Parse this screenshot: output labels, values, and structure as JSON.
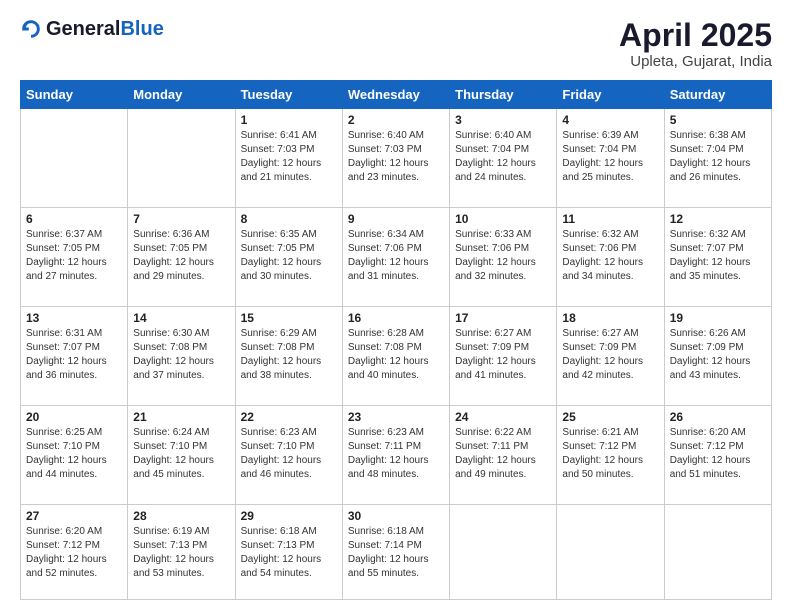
{
  "header": {
    "logo_general": "General",
    "logo_blue": "Blue",
    "title": "April 2025",
    "location": "Upleta, Gujarat, India"
  },
  "days_of_week": [
    "Sunday",
    "Monday",
    "Tuesday",
    "Wednesday",
    "Thursday",
    "Friday",
    "Saturday"
  ],
  "weeks": [
    [
      {
        "day": "",
        "info": ""
      },
      {
        "day": "",
        "info": ""
      },
      {
        "day": "1",
        "info": "Sunrise: 6:41 AM\nSunset: 7:03 PM\nDaylight: 12 hours and 21 minutes."
      },
      {
        "day": "2",
        "info": "Sunrise: 6:40 AM\nSunset: 7:03 PM\nDaylight: 12 hours and 23 minutes."
      },
      {
        "day": "3",
        "info": "Sunrise: 6:40 AM\nSunset: 7:04 PM\nDaylight: 12 hours and 24 minutes."
      },
      {
        "day": "4",
        "info": "Sunrise: 6:39 AM\nSunset: 7:04 PM\nDaylight: 12 hours and 25 minutes."
      },
      {
        "day": "5",
        "info": "Sunrise: 6:38 AM\nSunset: 7:04 PM\nDaylight: 12 hours and 26 minutes."
      }
    ],
    [
      {
        "day": "6",
        "info": "Sunrise: 6:37 AM\nSunset: 7:05 PM\nDaylight: 12 hours and 27 minutes."
      },
      {
        "day": "7",
        "info": "Sunrise: 6:36 AM\nSunset: 7:05 PM\nDaylight: 12 hours and 29 minutes."
      },
      {
        "day": "8",
        "info": "Sunrise: 6:35 AM\nSunset: 7:05 PM\nDaylight: 12 hours and 30 minutes."
      },
      {
        "day": "9",
        "info": "Sunrise: 6:34 AM\nSunset: 7:06 PM\nDaylight: 12 hours and 31 minutes."
      },
      {
        "day": "10",
        "info": "Sunrise: 6:33 AM\nSunset: 7:06 PM\nDaylight: 12 hours and 32 minutes."
      },
      {
        "day": "11",
        "info": "Sunrise: 6:32 AM\nSunset: 7:06 PM\nDaylight: 12 hours and 34 minutes."
      },
      {
        "day": "12",
        "info": "Sunrise: 6:32 AM\nSunset: 7:07 PM\nDaylight: 12 hours and 35 minutes."
      }
    ],
    [
      {
        "day": "13",
        "info": "Sunrise: 6:31 AM\nSunset: 7:07 PM\nDaylight: 12 hours and 36 minutes."
      },
      {
        "day": "14",
        "info": "Sunrise: 6:30 AM\nSunset: 7:08 PM\nDaylight: 12 hours and 37 minutes."
      },
      {
        "day": "15",
        "info": "Sunrise: 6:29 AM\nSunset: 7:08 PM\nDaylight: 12 hours and 38 minutes."
      },
      {
        "day": "16",
        "info": "Sunrise: 6:28 AM\nSunset: 7:08 PM\nDaylight: 12 hours and 40 minutes."
      },
      {
        "day": "17",
        "info": "Sunrise: 6:27 AM\nSunset: 7:09 PM\nDaylight: 12 hours and 41 minutes."
      },
      {
        "day": "18",
        "info": "Sunrise: 6:27 AM\nSunset: 7:09 PM\nDaylight: 12 hours and 42 minutes."
      },
      {
        "day": "19",
        "info": "Sunrise: 6:26 AM\nSunset: 7:09 PM\nDaylight: 12 hours and 43 minutes."
      }
    ],
    [
      {
        "day": "20",
        "info": "Sunrise: 6:25 AM\nSunset: 7:10 PM\nDaylight: 12 hours and 44 minutes."
      },
      {
        "day": "21",
        "info": "Sunrise: 6:24 AM\nSunset: 7:10 PM\nDaylight: 12 hours and 45 minutes."
      },
      {
        "day": "22",
        "info": "Sunrise: 6:23 AM\nSunset: 7:10 PM\nDaylight: 12 hours and 46 minutes."
      },
      {
        "day": "23",
        "info": "Sunrise: 6:23 AM\nSunset: 7:11 PM\nDaylight: 12 hours and 48 minutes."
      },
      {
        "day": "24",
        "info": "Sunrise: 6:22 AM\nSunset: 7:11 PM\nDaylight: 12 hours and 49 minutes."
      },
      {
        "day": "25",
        "info": "Sunrise: 6:21 AM\nSunset: 7:12 PM\nDaylight: 12 hours and 50 minutes."
      },
      {
        "day": "26",
        "info": "Sunrise: 6:20 AM\nSunset: 7:12 PM\nDaylight: 12 hours and 51 minutes."
      }
    ],
    [
      {
        "day": "27",
        "info": "Sunrise: 6:20 AM\nSunset: 7:12 PM\nDaylight: 12 hours and 52 minutes."
      },
      {
        "day": "28",
        "info": "Sunrise: 6:19 AM\nSunset: 7:13 PM\nDaylight: 12 hours and 53 minutes."
      },
      {
        "day": "29",
        "info": "Sunrise: 6:18 AM\nSunset: 7:13 PM\nDaylight: 12 hours and 54 minutes."
      },
      {
        "day": "30",
        "info": "Sunrise: 6:18 AM\nSunset: 7:14 PM\nDaylight: 12 hours and 55 minutes."
      },
      {
        "day": "",
        "info": ""
      },
      {
        "day": "",
        "info": ""
      },
      {
        "day": "",
        "info": ""
      }
    ]
  ]
}
